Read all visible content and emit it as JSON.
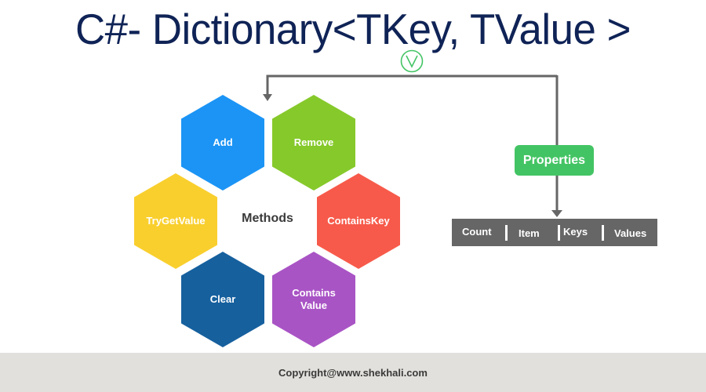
{
  "title": "C#- Dictionary<TKey, TValue >",
  "icons": {
    "top": "check-circle-icon"
  },
  "methods": {
    "label": "Methods",
    "items": [
      {
        "label": "Add",
        "color": "#1b94f5"
      },
      {
        "label": "Remove",
        "color": "#86c92b"
      },
      {
        "label": "TryGetValue",
        "color": "#f9cf2e"
      },
      {
        "label": "ContainsKey",
        "color": "#f75a4a"
      },
      {
        "label": "Clear",
        "color": "#16609e"
      },
      {
        "label": "Contains Value",
        "color": "#a954c5"
      }
    ]
  },
  "properties": {
    "label": "Properties",
    "color": "#43c464",
    "items": [
      "Count",
      "Item",
      "Keys",
      "Values"
    ]
  },
  "colors": {
    "title": "#0f2356",
    "connector": "#666666",
    "bar": "#666666",
    "footer_bg": "#e2e0dc"
  },
  "footer": {
    "text": "Copyright@www.shekhali.com"
  }
}
